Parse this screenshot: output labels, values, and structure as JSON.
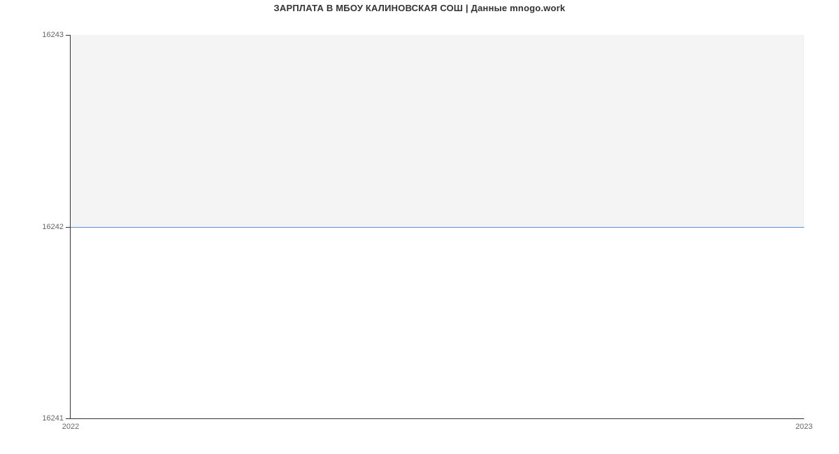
{
  "chart_data": {
    "type": "area",
    "title": "ЗАРПЛАТА В МБОУ КАЛИНОВСКАЯ СОШ | Данные mnogo.work",
    "x": [
      2022,
      2023
    ],
    "values": [
      16242,
      16242
    ],
    "xlabel": "",
    "ylabel": "",
    "ylim": [
      16241,
      16243
    ],
    "xlim": [
      2022,
      2023
    ],
    "y_ticks": [
      16241,
      16242,
      16243
    ],
    "x_ticks": [
      2022,
      2023
    ],
    "line_color": "#5a8fd6",
    "fill_color": "#f4f4f4"
  }
}
